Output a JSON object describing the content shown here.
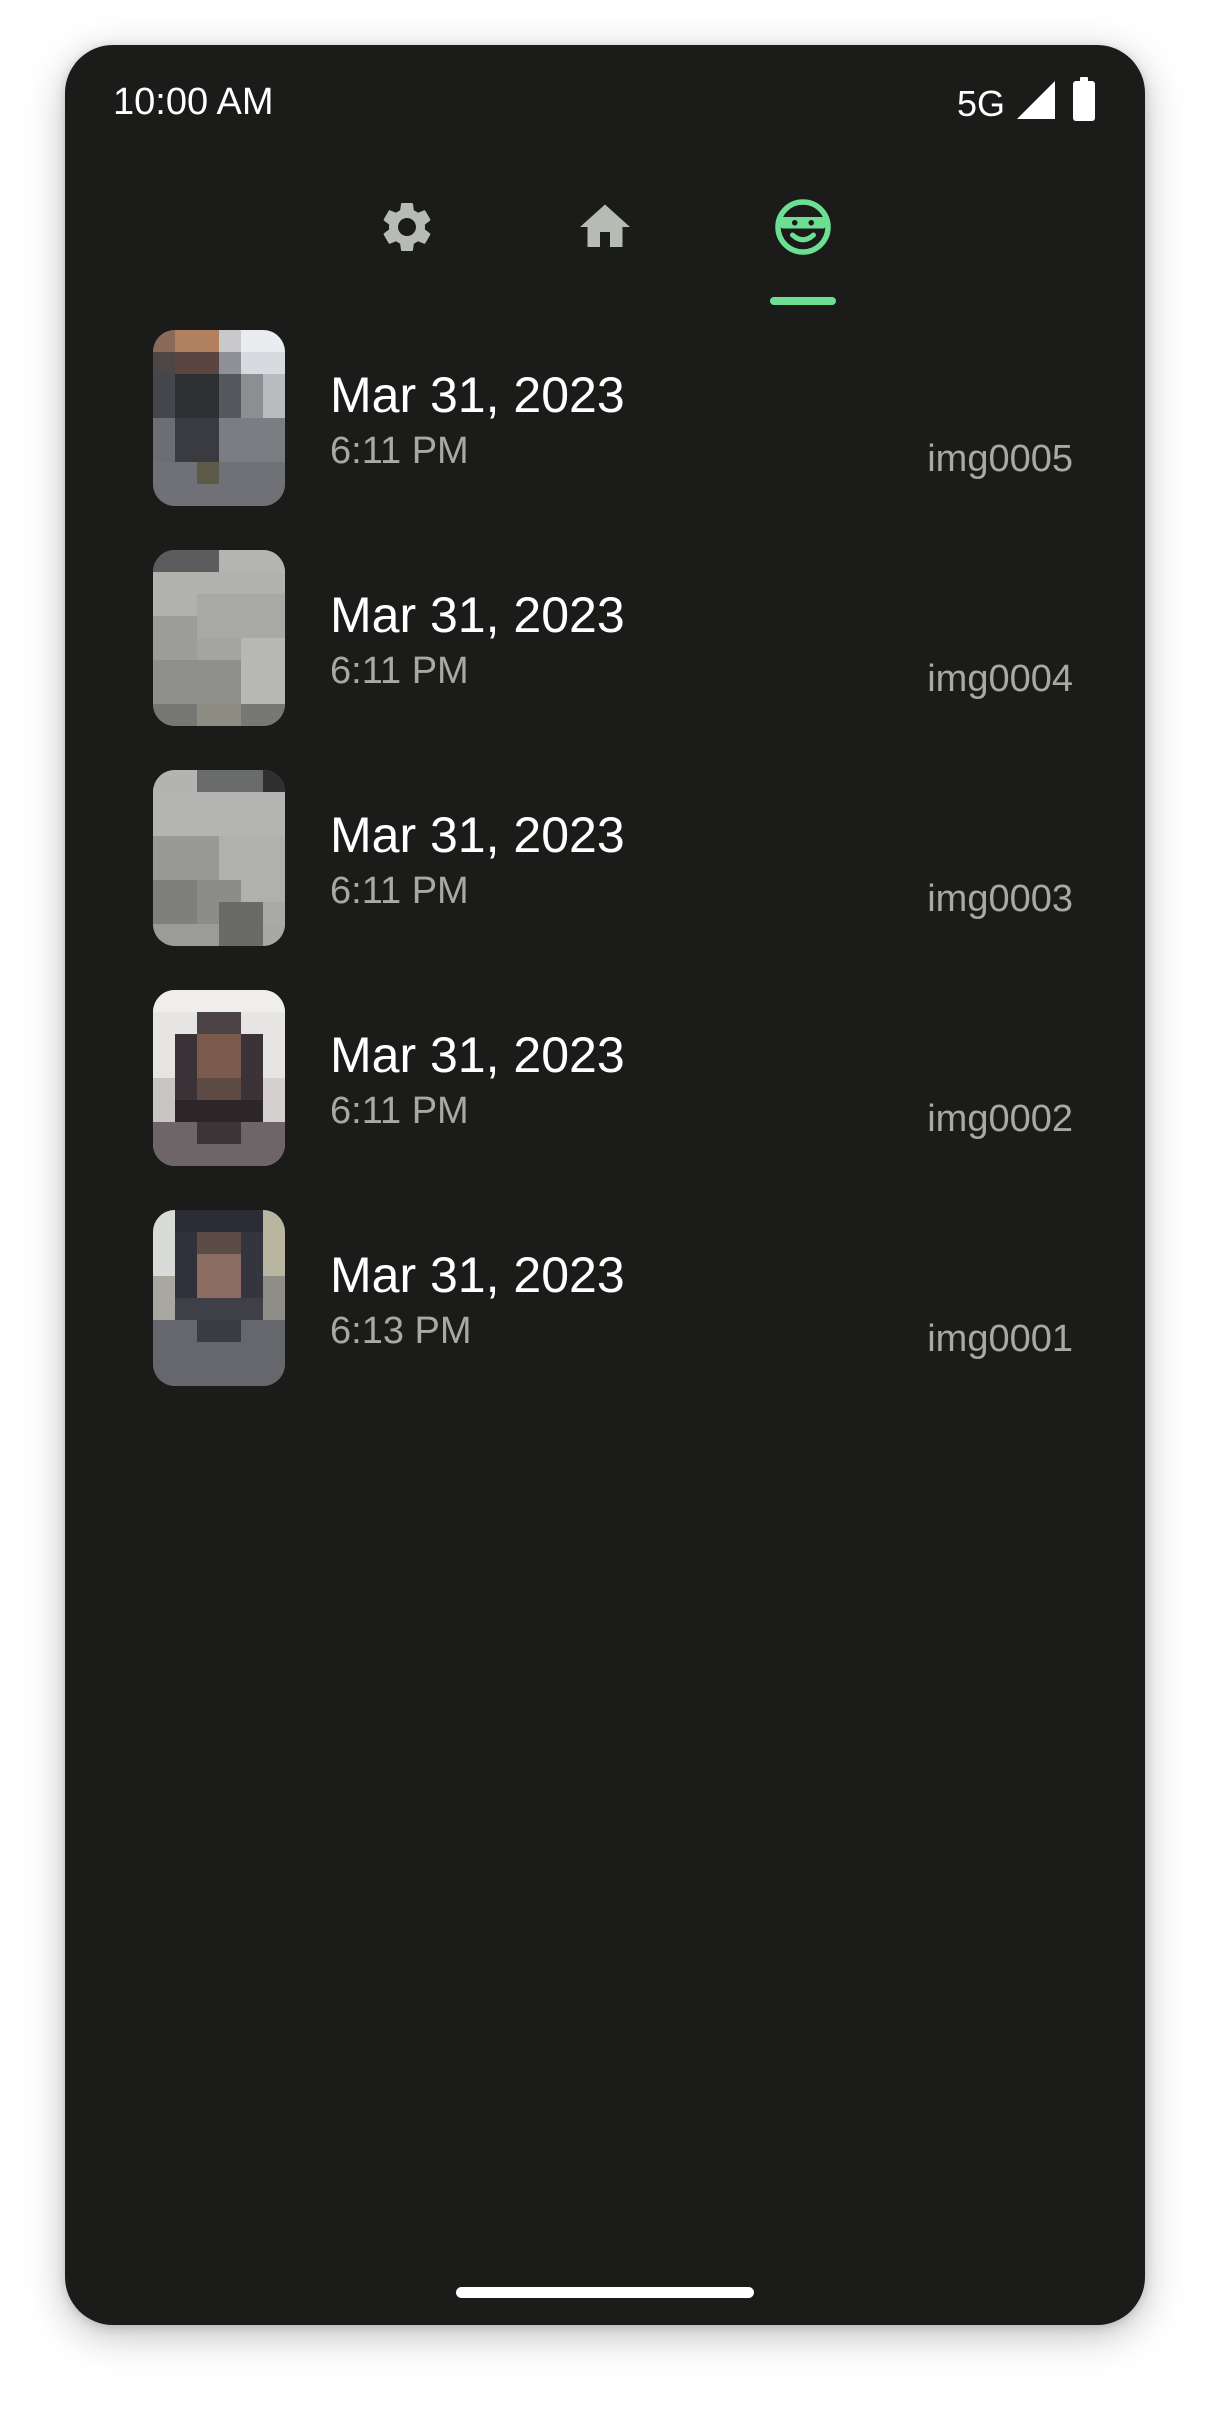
{
  "status_bar": {
    "time": "10:00 AM",
    "network": "5G",
    "signal_icon": "signal-icon",
    "battery_icon": "battery-icon"
  },
  "tabs": [
    {
      "icon": "gear-icon",
      "selected": false
    },
    {
      "icon": "home-icon",
      "selected": false
    },
    {
      "icon": "incognito-face-icon",
      "selected": true
    }
  ],
  "colors": {
    "background": "#1b1c1a",
    "accent": "#6ddf94",
    "icon_muted": "#b6bbb3",
    "primary_text": "#ffffff",
    "secondary_text": "#a7a9a4"
  },
  "images": [
    {
      "date": "Mar 31, 2023",
      "time": "6:11 PM",
      "name": "img0005"
    },
    {
      "date": "Mar 31, 2023",
      "time": "6:11 PM",
      "name": "img0004"
    },
    {
      "date": "Mar 31, 2023",
      "time": "6:11 PM",
      "name": "img0003"
    },
    {
      "date": "Mar 31, 2023",
      "time": "6:11 PM",
      "name": "img0002"
    },
    {
      "date": "Mar 31, 2023",
      "time": "6:13 PM",
      "name": "img0001"
    }
  ]
}
